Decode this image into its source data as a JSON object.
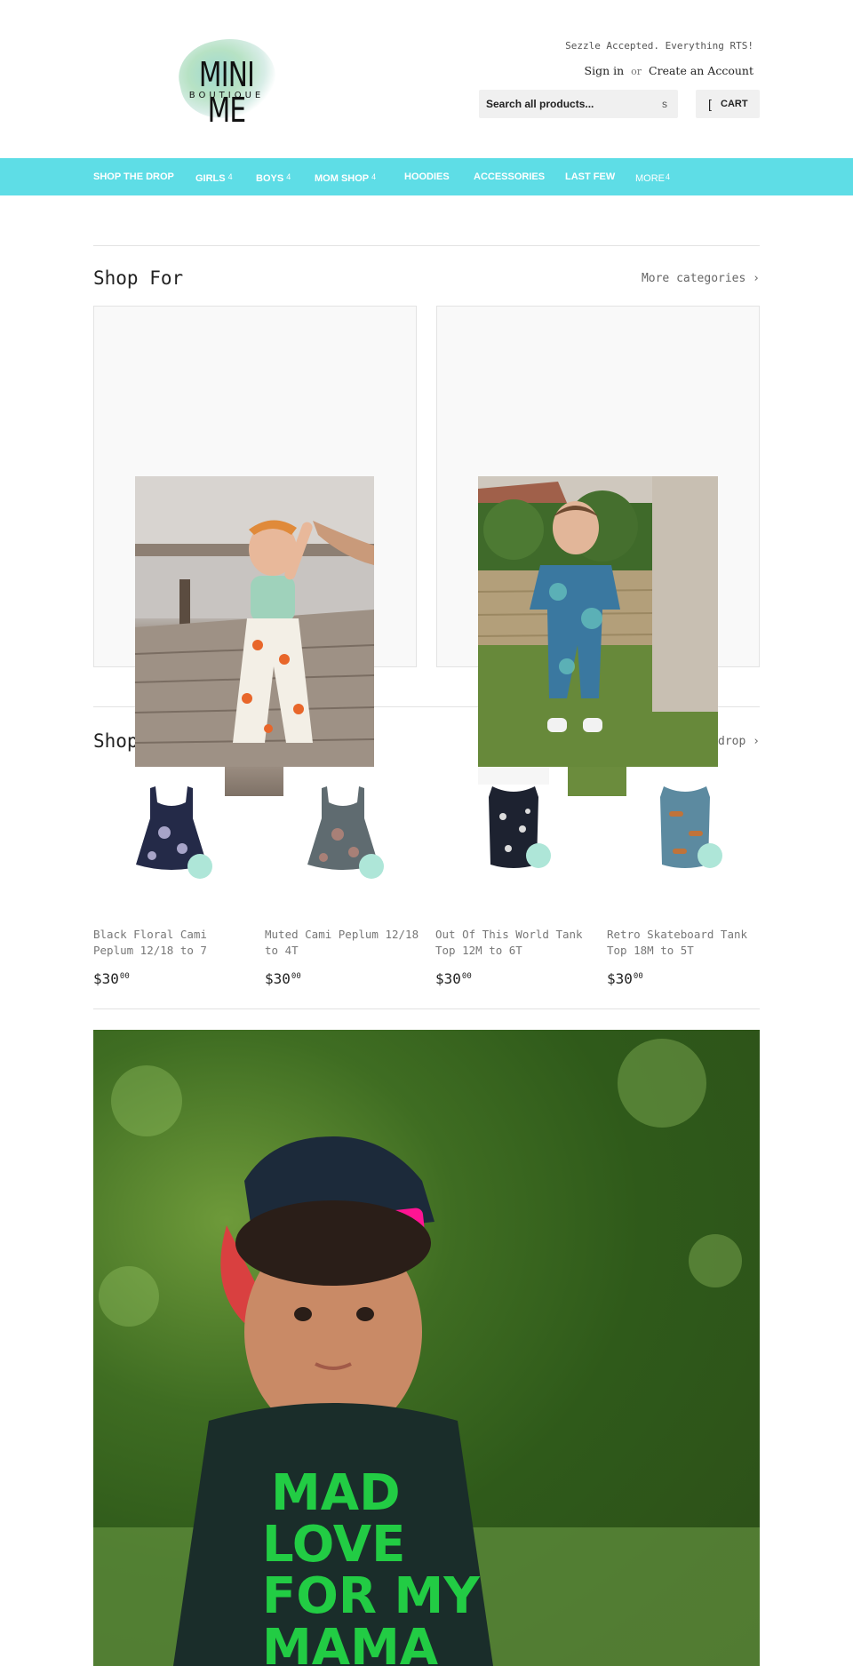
{
  "header": {
    "logo_title": "MINI ME",
    "logo_subtitle": "BOUTIQUE",
    "promo": "Sezzle Accepted. Everything RTS!",
    "sign_in": "Sign in",
    "or": "or",
    "create_account": "Create an Account",
    "search_placeholder": "Search all products...",
    "search_icon_glyph": "s",
    "cart_icon_glyph": "[",
    "cart_label": "CART"
  },
  "nav": {
    "items": [
      {
        "label": "SHOP THE DROP",
        "caret": ""
      },
      {
        "label": "GIRLS",
        "caret": "4"
      },
      {
        "label": "BOYS",
        "caret": "4"
      },
      {
        "label": "MOM SHOP",
        "caret": "4"
      },
      {
        "label": "HOODIES",
        "caret": ""
      },
      {
        "label": "ACCESSORIES",
        "caret": ""
      },
      {
        "label": "LAST FEW",
        "caret": ""
      },
      {
        "label": "MORE",
        "caret": "4"
      }
    ]
  },
  "shop_for": {
    "title": "Shop For",
    "more_link": "More categories ›"
  },
  "shop_drop": {
    "title": "Shop",
    "more_link": "drop ›"
  },
  "products": [
    {
      "name": "Black Floral Cami Peplum 12/18 to 7",
      "price": "$30",
      "cents": "00",
      "color": "#242a48"
    },
    {
      "name": "Muted Cami Peplum 12/18 to 4T",
      "price": "$30",
      "cents": "00",
      "color": "#5f6b70"
    },
    {
      "name": "Out Of This World Tank Top 12M to 6T",
      "price": "$30",
      "cents": "00",
      "color": "#1d2230"
    },
    {
      "name": "Retro Skateboard Tank Top 18M to 5T",
      "price": "$30",
      "cents": "00",
      "color": "#5c8aa0"
    }
  ],
  "hero": {
    "shirt_text": [
      "MAD",
      "LOVE",
      "FOR MY",
      "MAMA"
    ]
  },
  "colors": {
    "nav_bg": "#5edde6",
    "hero_text": "#22cc44",
    "cap_strap": "#ff1493"
  }
}
